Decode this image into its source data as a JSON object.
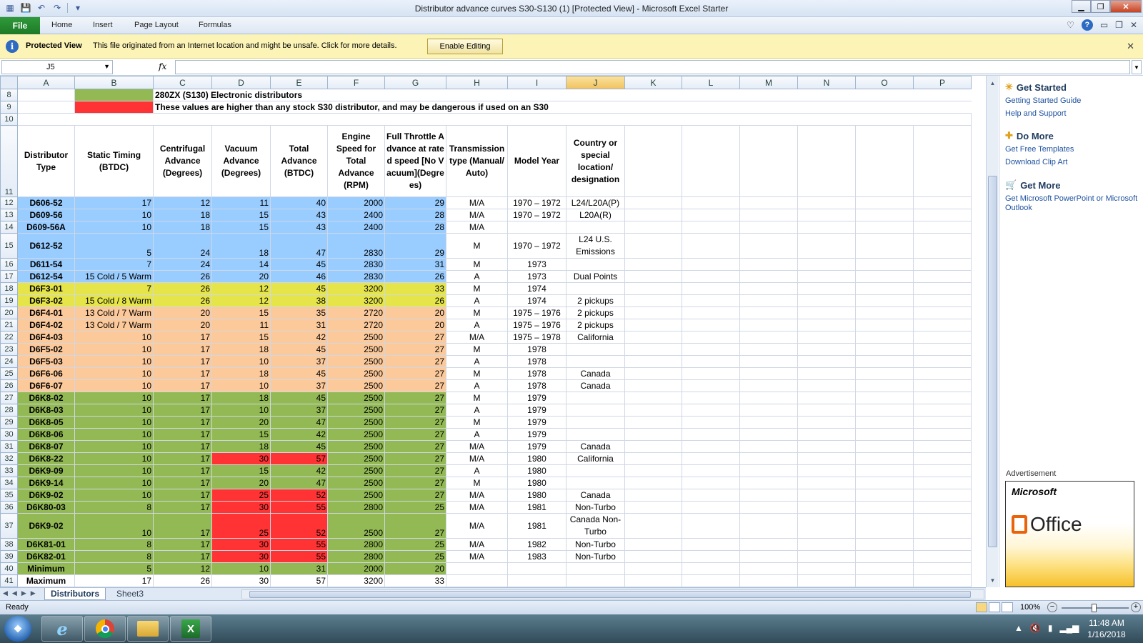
{
  "window": {
    "title": "Distributor advance curves S30-S130 (1)  [Protected View]  -  Microsoft Excel Starter"
  },
  "ribbon": {
    "file": "File",
    "tabs": [
      "Home",
      "Insert",
      "Page Layout",
      "Formulas"
    ]
  },
  "protected_view": {
    "heading": "Protected View",
    "message": "This file originated from an Internet location and might be unsafe. Click for more details.",
    "button": "Enable Editing"
  },
  "formula_bar": {
    "name_box": "J5",
    "fx": "fx",
    "value": ""
  },
  "columns": [
    "A",
    "B",
    "C",
    "D",
    "E",
    "F",
    "G",
    "H",
    "I",
    "J",
    "K",
    "L",
    "M",
    "N",
    "O",
    "P"
  ],
  "selected_column": "J",
  "legend": {
    "row8_text": "280ZX (S130) Electronic distributors",
    "row9_text": "These values are higher than any stock S30 distributor, and may be dangerous if used on an  S30"
  },
  "headers": [
    "Distributor Type",
    "Static Timing (BTDC)",
    "Centrifugal Advance (Degrees)",
    "Vacuum Advance (Degrees)",
    "Total Advance (BTDC)",
    "Engine Speed for Total Advance (RPM)",
    "Full Throttle Advance at rated speed [No Vacuum](Degrees)",
    "Transmission type (Manual/ Auto)",
    "Model Year",
    "Country or special location/ designation"
  ],
  "rows": [
    {
      "n": "12",
      "type": "D606-52",
      "static": "17",
      "cent": "12",
      "vac": "11",
      "total": "40",
      "rpm": "2000",
      "full": "29",
      "trans": "M/A",
      "year": "1970 – 1972",
      "country": "L24/L20A(P)"
    },
    {
      "n": "13",
      "type": "D609-56",
      "static": "10",
      "cent": "18",
      "vac": "15",
      "total": "43",
      "rpm": "2400",
      "full": "28",
      "trans": "M/A",
      "year": "1970 – 1972",
      "country": "L20A(R)"
    },
    {
      "n": "14",
      "type": "D609-56A",
      "static": "10",
      "cent": "18",
      "vac": "15",
      "total": "43",
      "rpm": "2400",
      "full": "28",
      "trans": "M/A",
      "year": "",
      "country": ""
    },
    {
      "n": "15",
      "type": "D612-52",
      "static": "5",
      "cent": "24",
      "vac": "18",
      "total": "47",
      "rpm": "2830",
      "full": "29",
      "trans": "M",
      "year": "1970 – 1972",
      "country": "L24 U.S. Emissions"
    },
    {
      "n": "16",
      "type": "D611-54",
      "static": "7",
      "cent": "24",
      "vac": "14",
      "total": "45",
      "rpm": "2830",
      "full": "31",
      "trans": "M",
      "year": "1973",
      "country": ""
    },
    {
      "n": "17",
      "type": "D612-54",
      "static": "15 Cold / 5 Warm",
      "cent": "26",
      "vac": "20",
      "total": "46",
      "rpm": "2830",
      "full": "26",
      "trans": "A",
      "year": "1973",
      "country": "Dual Points"
    },
    {
      "n": "18",
      "type": "D6F3-01",
      "static": "7",
      "cent": "26",
      "vac": "12",
      "total": "45",
      "rpm": "3200",
      "full": "33",
      "trans": "M",
      "year": "1974",
      "country": ""
    },
    {
      "n": "19",
      "type": "D6F3-02",
      "static": "15 Cold / 8 Warm",
      "cent": "26",
      "vac": "12",
      "total": "38",
      "rpm": "3200",
      "full": "26",
      "trans": "A",
      "year": "1974",
      "country": "2 pickups"
    },
    {
      "n": "20",
      "type": "D6F4-01",
      "static": "13 Cold / 7 Warm",
      "cent": "20",
      "vac": "15",
      "total": "35",
      "rpm": "2720",
      "full": "20",
      "trans": "M",
      "year": "1975 – 1976",
      "country": "2 pickups"
    },
    {
      "n": "21",
      "type": "D6F4-02",
      "static": "13 Cold / 7 Warm",
      "cent": "20",
      "vac": "11",
      "total": "31",
      "rpm": "2720",
      "full": "20",
      "trans": "A",
      "year": "1975 – 1976",
      "country": "2 pickups"
    },
    {
      "n": "22",
      "type": "D6F4-03",
      "static": "10",
      "cent": "17",
      "vac": "15",
      "total": "42",
      "rpm": "2500",
      "full": "27",
      "trans": "M/A",
      "year": "1975 – 1978",
      "country": "California"
    },
    {
      "n": "23",
      "type": "D6F5-02",
      "static": "10",
      "cent": "17",
      "vac": "18",
      "total": "45",
      "rpm": "2500",
      "full": "27",
      "trans": "M",
      "year": "1978",
      "country": ""
    },
    {
      "n": "24",
      "type": "D6F5-03",
      "static": "10",
      "cent": "17",
      "vac": "10",
      "total": "37",
      "rpm": "2500",
      "full": "27",
      "trans": "A",
      "year": "1978",
      "country": ""
    },
    {
      "n": "25",
      "type": "D6F6-06",
      "static": "10",
      "cent": "17",
      "vac": "18",
      "total": "45",
      "rpm": "2500",
      "full": "27",
      "trans": "M",
      "year": "1978",
      "country": "Canada"
    },
    {
      "n": "26",
      "type": "D6F6-07",
      "static": "10",
      "cent": "17",
      "vac": "10",
      "total": "37",
      "rpm": "2500",
      "full": "27",
      "trans": "A",
      "year": "1978",
      "country": "Canada"
    },
    {
      "n": "27",
      "type": "D6K8-02",
      "static": "10",
      "cent": "17",
      "vac": "18",
      "total": "45",
      "rpm": "2500",
      "full": "27",
      "trans": "M",
      "year": "1979",
      "country": ""
    },
    {
      "n": "28",
      "type": "D6K8-03",
      "static": "10",
      "cent": "17",
      "vac": "10",
      "total": "37",
      "rpm": "2500",
      "full": "27",
      "trans": "A",
      "year": "1979",
      "country": ""
    },
    {
      "n": "29",
      "type": "D6K8-05",
      "static": "10",
      "cent": "17",
      "vac": "20",
      "total": "47",
      "rpm": "2500",
      "full": "27",
      "trans": "M",
      "year": "1979",
      "country": ""
    },
    {
      "n": "30",
      "type": "D6K8-06",
      "static": "10",
      "cent": "17",
      "vac": "15",
      "total": "42",
      "rpm": "2500",
      "full": "27",
      "trans": "A",
      "year": "1979",
      "country": ""
    },
    {
      "n": "31",
      "type": "D6K8-07",
      "static": "10",
      "cent": "17",
      "vac": "18",
      "total": "45",
      "rpm": "2500",
      "full": "27",
      "trans": "M/A",
      "year": "1979",
      "country": "Canada"
    },
    {
      "n": "32",
      "type": "D6K8-22",
      "static": "10",
      "cent": "17",
      "vac": "30",
      "total": "57",
      "rpm": "2500",
      "full": "27",
      "trans": "M/A",
      "year": "1980",
      "country": "California"
    },
    {
      "n": "33",
      "type": "D6K9-09",
      "static": "10",
      "cent": "17",
      "vac": "15",
      "total": "42",
      "rpm": "2500",
      "full": "27",
      "trans": "A",
      "year": "1980",
      "country": ""
    },
    {
      "n": "34",
      "type": "D6K9-14",
      "static": "10",
      "cent": "17",
      "vac": "20",
      "total": "47",
      "rpm": "2500",
      "full": "27",
      "trans": "M",
      "year": "1980",
      "country": ""
    },
    {
      "n": "35",
      "type": "D6K9-02",
      "static": "10",
      "cent": "17",
      "vac": "25",
      "total": "52",
      "rpm": "2500",
      "full": "27",
      "trans": "M/A",
      "year": "1980",
      "country": "Canada"
    },
    {
      "n": "36",
      "type": "D6K80-03",
      "static": "8",
      "cent": "17",
      "vac": "30",
      "total": "55",
      "rpm": "2800",
      "full": "25",
      "trans": "M/A",
      "year": "1981",
      "country": "Non-Turbo"
    },
    {
      "n": "37",
      "type": "D6K9-02",
      "static": "10",
      "cent": "17",
      "vac": "25",
      "total": "52",
      "rpm": "2500",
      "full": "27",
      "trans": "M/A",
      "year": "1981",
      "country": "Canada  Non-Turbo"
    },
    {
      "n": "38",
      "type": "D6K81-01",
      "static": "8",
      "cent": "17",
      "vac": "30",
      "total": "55",
      "rpm": "2800",
      "full": "25",
      "trans": "M/A",
      "year": "1982",
      "country": "Non-Turbo"
    },
    {
      "n": "39",
      "type": "D6K82-01",
      "static": "8",
      "cent": "17",
      "vac": "30",
      "total": "55",
      "rpm": "2800",
      "full": "25",
      "trans": "M/A",
      "year": "1983",
      "country": "Non-Turbo"
    },
    {
      "n": "40",
      "type": "Minimum",
      "static": "5",
      "cent": "12",
      "vac": "10",
      "total": "31",
      "rpm": "2000",
      "full": "20",
      "trans": "",
      "year": "",
      "country": ""
    },
    {
      "n": "41",
      "type": "Maximum",
      "static": "17",
      "cent": "26",
      "vac": "30",
      "total": "57",
      "rpm": "3200",
      "full": "33",
      "trans": "",
      "year": "",
      "country": ""
    }
  ],
  "task_pane": {
    "get_started": "Get Started",
    "getting_started_guide": "Getting Started Guide",
    "help_support": "Help and Support",
    "do_more": "Do More",
    "free_templates": "Get Free Templates",
    "clip_art": "Download Clip Art",
    "get_more": "Get More",
    "ppt_outlook": "Get Microsoft PowerPoint or Microsoft Outlook",
    "ad_label": "Advertisement",
    "ad_brand": "Microsoft",
    "ad_product": "Office"
  },
  "sheets": [
    "Distributors",
    "Sheet3"
  ],
  "status": {
    "ready": "Ready",
    "zoom": "100%"
  },
  "taskbar": {
    "time": "11:48 AM",
    "date": "1/16/2018"
  },
  "colors": {
    "blue": "#99ccff",
    "yellow": "#e5e54a",
    "peach": "#fcc99b",
    "green": "#92b954",
    "red": "#ff3333"
  }
}
